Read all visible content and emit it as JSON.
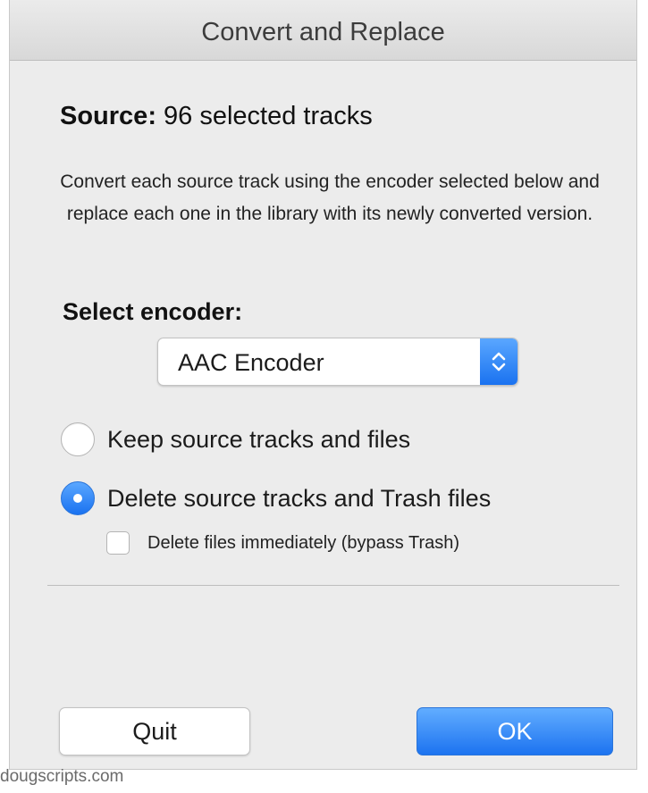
{
  "window": {
    "title": "Convert and Replace"
  },
  "source": {
    "label": "Source:",
    "value": "96 selected tracks"
  },
  "description": "Convert each source track using the encoder selected below and replace each one in the library with its newly converted version.",
  "encoder": {
    "label": "Select encoder:",
    "selected": "AAC Encoder",
    "stepper_icon": "up-down-chevron-icon"
  },
  "options": {
    "keep": {
      "label": "Keep source tracks and files",
      "selected": false
    },
    "delete": {
      "label": "Delete source tracks and Trash files",
      "selected": true
    },
    "delete_immediately": {
      "label": "Delete files immediately (bypass Trash)",
      "checked": false
    }
  },
  "buttons": {
    "quit": "Quit",
    "ok": "OK"
  },
  "footer": "dougscripts.com",
  "colors": {
    "accent": "#1a72f0",
    "background": "#ececec"
  }
}
